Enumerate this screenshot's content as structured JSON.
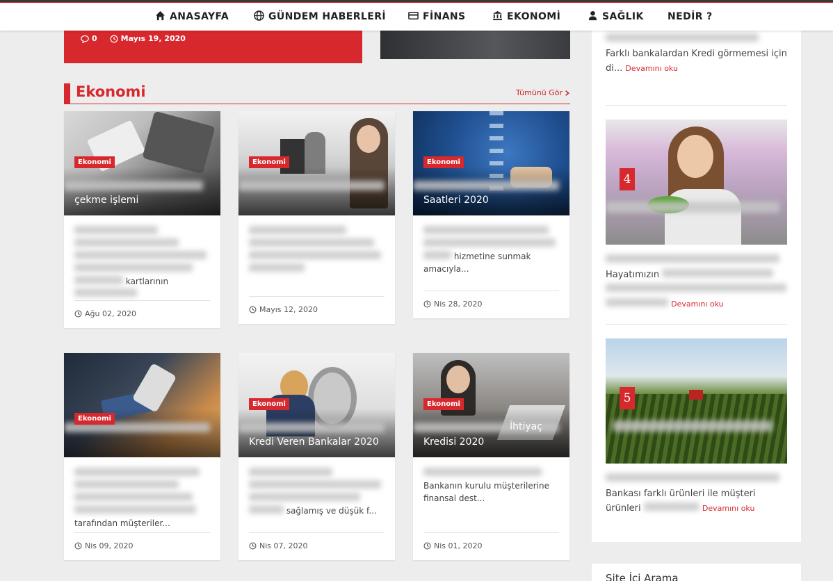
{
  "nav": {
    "items": [
      {
        "label": "ANASAYFA",
        "icon": "home-icon"
      },
      {
        "label": "GÜNDEM HABERLERİ",
        "icon": "globe-icon"
      },
      {
        "label": "FİNANS",
        "icon": "credit-card-icon"
      },
      {
        "label": "EKONOMİ",
        "icon": "bank-icon"
      },
      {
        "label": "SAĞLIK",
        "icon": "doctor-icon"
      },
      {
        "label": "NEDİR ?",
        "icon": ""
      }
    ]
  },
  "top_card": {
    "comments": "0",
    "date": "Mayıs 19, 2020"
  },
  "section": {
    "title": "Ekonomi",
    "see_all": "Tümünü Gör"
  },
  "cards": [
    {
      "category": "Ekonomi",
      "title": "çekme işlemi",
      "excerpt_visible": "kartlarının",
      "date": "Ağu 02, 2020"
    },
    {
      "category": "Ekonomi",
      "title": "",
      "excerpt_visible": "",
      "date": "Mayıs 12, 2020"
    },
    {
      "category": "Ekonomi",
      "title": "Saatleri 2020",
      "excerpt_visible": "hizmetine sunmak amacıyla...",
      "date": "Nis 28, 2020"
    },
    {
      "category": "Ekonomi",
      "title": "",
      "excerpt_visible": "tarafından müşteriler...",
      "date": "Nis 09, 2020"
    },
    {
      "category": "Ekonomi",
      "title": "Kredi Veren Bankalar 2020",
      "excerpt_visible": "sağlamış ve düşük f...",
      "date": "Nis 07, 2020"
    },
    {
      "category": "Ekonomi",
      "title": "Kredisi 2020",
      "title_extra": "İhtiyaç",
      "excerpt_visible": "Bankanın kurulu müşterilerine finansal dest...",
      "date": "Nis 01, 2020"
    }
  ],
  "sidebar": {
    "item3_text": "Farklı bankalardan Kredi görmemesi için di...",
    "item4_num": "4",
    "item4_text": "Hayatımızın",
    "item5_num": "5",
    "item5_text": "Bankası farklı ürünleri ile müşteri ürünleri",
    "more_label": "Devamını oku",
    "search_title": "Site İçi Arama"
  }
}
